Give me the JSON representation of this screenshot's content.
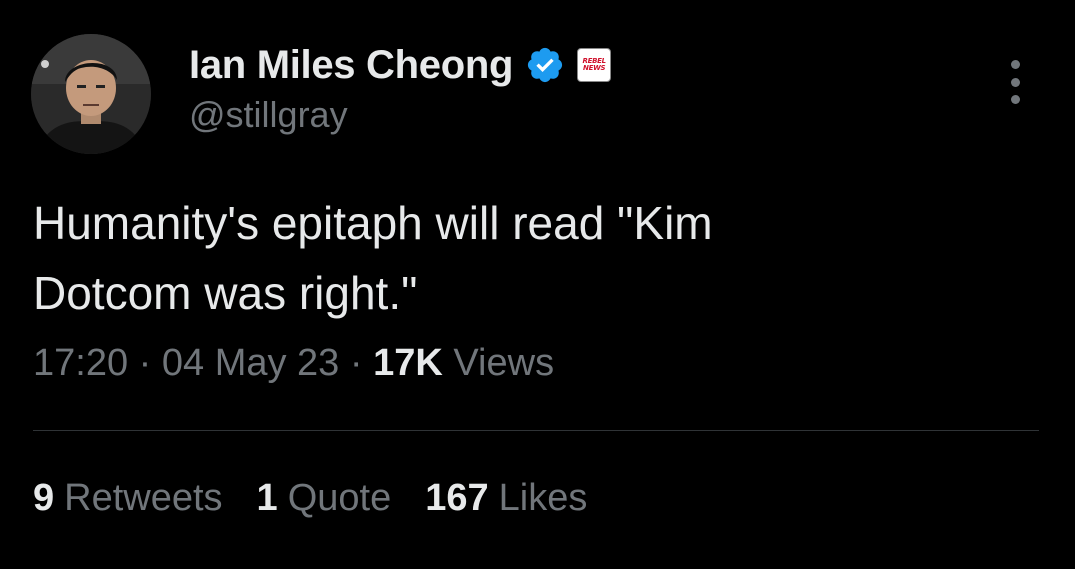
{
  "author": {
    "display_name": "Ian Miles Cheong",
    "handle": "@stillgray",
    "verified_icon": "verified-badge-icon",
    "affiliation_badge": [
      "REBEL",
      "NEWS"
    ],
    "avatar": "profile-photo"
  },
  "tweet": {
    "text_line1": "Humanity's epitaph will read \"Kim",
    "text_line2": "Dotcom was right.\""
  },
  "meta": {
    "time": "17:20",
    "separator": "·",
    "date": "04 May 23",
    "views_count": "17K",
    "views_label": "Views"
  },
  "stats": {
    "retweets_count": "9",
    "retweets_label": "Retweets",
    "quotes_count": "1",
    "quotes_label": "Quote",
    "likes_count": "167",
    "likes_label": "Likes"
  },
  "colors": {
    "background": "#000000",
    "primary_text": "#e7e9ea",
    "secondary_text": "#71767b",
    "verified_blue": "#1d9bf0",
    "divider": "#2f3336"
  }
}
